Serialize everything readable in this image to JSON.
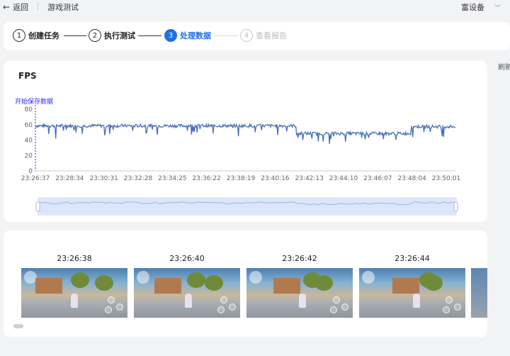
{
  "header": {
    "back_label": "返回",
    "page_title": "游戏测试",
    "device_label": "富设备"
  },
  "steps": [
    {
      "number": "1",
      "label": "创建任务",
      "state": "done"
    },
    {
      "number": "2",
      "label": "执行测试",
      "state": "done"
    },
    {
      "number": "3",
      "label": "处理数据",
      "state": "active"
    },
    {
      "number": "4",
      "label": "查看报告",
      "state": "todo"
    }
  ],
  "side_label": "刷新",
  "chart_title": "FPS",
  "chart_data": {
    "type": "line",
    "title": "FPS",
    "annotation": "开始保存数据",
    "x_tick_labels": [
      "23:26:37",
      "23:28:34",
      "23:30:31",
      "23:32:28",
      "23:34:25",
      "23:36:22",
      "23:38:19",
      "23:40:16",
      "23:42:13",
      "23:44:10",
      "23:46:07",
      "23:48:04",
      "23:50:01"
    ],
    "y_ticks": [
      0,
      20,
      40,
      60,
      80
    ],
    "ylim": [
      0,
      80
    ],
    "xlim_minutes": [
      0,
      24.5
    ],
    "grid": false,
    "series": [
      {
        "color": "#4a6fba",
        "segments": [
          {
            "x_min": [
              0,
              18.9
            ],
            "base": 59,
            "noise": 2.5
          },
          {
            "x_min": [
              18.9,
              25.5
            ],
            "base": 49,
            "noise": 2.0
          },
          {
            "x_min": [
              25.5,
              29.5
            ],
            "base": 48,
            "noise": 2.0
          },
          {
            "x_min": [
              29.5,
              30.8
            ],
            "base": 50,
            "noise": 1.5
          },
          {
            "x_min": [
              30.8,
              29.9
            ],
            "base": 57,
            "noise": 2.5
          }
        ],
        "dips": [
          [
            1.0,
            48
          ],
          [
            1.5,
            42
          ],
          [
            3.0,
            50
          ],
          [
            5.5,
            48
          ],
          [
            7.2,
            52
          ],
          [
            9.0,
            47
          ],
          [
            11.2,
            52
          ],
          [
            15.0,
            45
          ],
          [
            16.2,
            50
          ],
          [
            22.0,
            45
          ],
          [
            24.6,
            43
          ],
          [
            27.0,
            48
          ],
          [
            30.0,
            45
          ]
        ]
      }
    ],
    "color": "#4a6fba"
  },
  "screenshots": [
    {
      "timestamp": "23:26:38"
    },
    {
      "timestamp": "23:26:40"
    },
    {
      "timestamp": "23:26:42"
    },
    {
      "timestamp": "23:26:44"
    }
  ]
}
